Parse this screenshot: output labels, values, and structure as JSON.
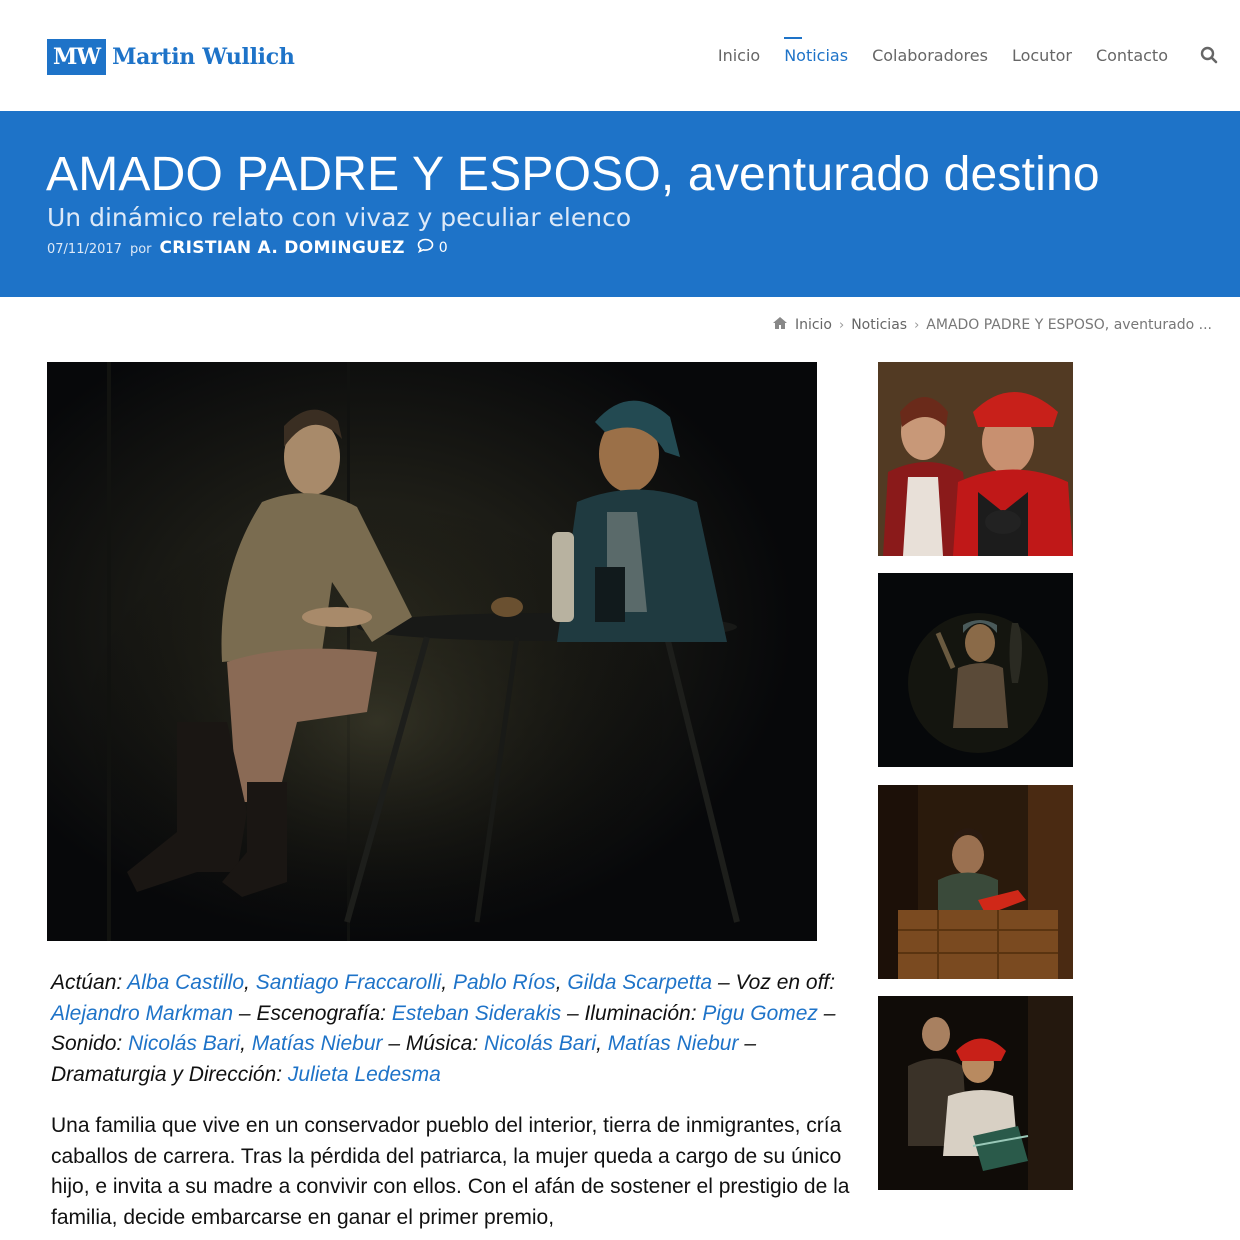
{
  "site": {
    "logo_mark": "MW",
    "logo_name": "Martin Wullich",
    "social_colors": [
      "#3b5998",
      "#1da1f2",
      "#f58220",
      "#33aaff",
      "#dd4b39"
    ]
  },
  "nav": {
    "items": [
      {
        "label": "Inicio",
        "active": false
      },
      {
        "label": "Noticias",
        "active": true
      },
      {
        "label": "Colaboradores",
        "active": false
      },
      {
        "label": "Locutor",
        "active": false
      },
      {
        "label": "Contacto",
        "active": false
      }
    ],
    "search_icon": "search-icon"
  },
  "article": {
    "title": "AMADO PADRE Y ESPOSO, aventurado destino",
    "subtitle": "Un dinámico relato con vivaz y peculiar elenco",
    "date": "07/11/2017",
    "by": "por",
    "author": "CRISTIAN A. DOMINGUEZ",
    "comment_count": "0"
  },
  "breadcrumb": {
    "home": "Inicio",
    "section": "Noticias",
    "current": "AMADO PADRE Y ESPOSO, aventurado ..."
  },
  "credits": [
    {
      "type": "text",
      "value": "Actúan: "
    },
    {
      "type": "link",
      "value": "Alba Castillo"
    },
    {
      "type": "text",
      "value": ", "
    },
    {
      "type": "link",
      "value": "Santiago Fraccarolli"
    },
    {
      "type": "text",
      "value": ", "
    },
    {
      "type": "link",
      "value": "Pablo Ríos"
    },
    {
      "type": "text",
      "value": ", "
    },
    {
      "type": "link",
      "value": "Gilda Scarpetta"
    },
    {
      "type": "text",
      "value": " – Voz en off: "
    },
    {
      "type": "link",
      "value": "Alejandro Markman"
    },
    {
      "type": "text",
      "value": " – Escenografía: "
    },
    {
      "type": "link",
      "value": "Esteban Siderakis"
    },
    {
      "type": "text",
      "value": " – Iluminación: "
    },
    {
      "type": "link",
      "value": "Pigu Gomez"
    },
    {
      "type": "text",
      "value": " – Sonido: "
    },
    {
      "type": "link",
      "value": "Nicolás Bari"
    },
    {
      "type": "text",
      "value": ", "
    },
    {
      "type": "link",
      "value": "Matías Niebur"
    },
    {
      "type": "text",
      "value": " – Música: "
    },
    {
      "type": "link",
      "value": "Nicolás Bari"
    },
    {
      "type": "text",
      "value": ", "
    },
    {
      "type": "link",
      "value": "Matías Niebur"
    },
    {
      "type": "text",
      "value": " – Dramaturgia y Dirección: "
    },
    {
      "type": "link",
      "value": "Julieta Ledesma"
    }
  ],
  "body_paragraph": "Una familia que vive en un conservador pueblo del interior, tierra de inmigrantes, cría caballos de carrera. Tras la pérdida del patriarca, la mujer queda a cargo de su único hijo, e invita a su madre a convivir con ellos. Con el afán de sostener el prestigio de la familia, decide embarcarse en ganar el primer premio,"
}
